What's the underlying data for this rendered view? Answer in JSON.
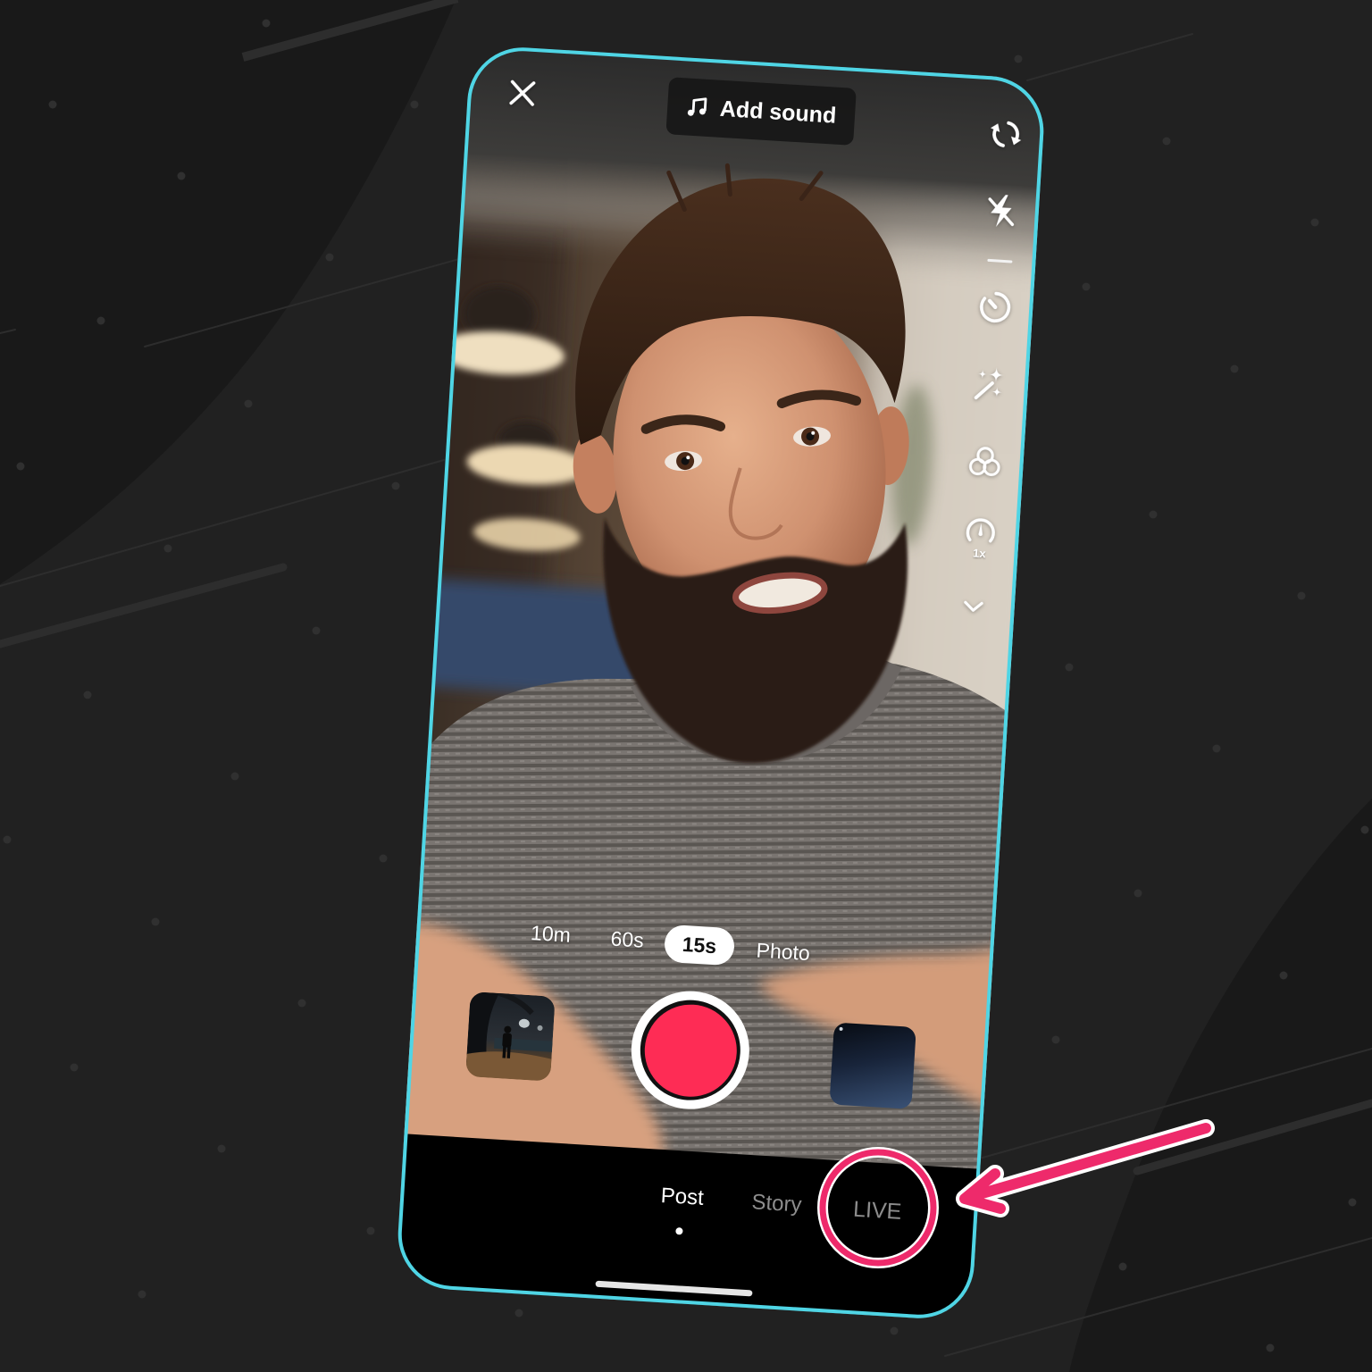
{
  "top_bar": {
    "close_icon": "close-icon",
    "add_sound": {
      "icon": "music-note-icon",
      "label": "Add sound"
    }
  },
  "side_tools": [
    {
      "name": "flip-camera",
      "icon": "flip-camera-icon"
    },
    {
      "name": "flash",
      "icon": "flash-off-icon",
      "state": "off"
    },
    {
      "name": "timer",
      "icon": "timer-icon"
    },
    {
      "name": "effects",
      "icon": "magic-wand-icon"
    },
    {
      "name": "filters",
      "icon": "filters-icon"
    },
    {
      "name": "speed",
      "icon": "speed-icon",
      "badge": "1x"
    },
    {
      "name": "more-tools",
      "icon": "chevron-down-icon"
    }
  ],
  "duration_tabs": [
    {
      "label": "10m",
      "selected": false
    },
    {
      "label": "60s",
      "selected": false
    },
    {
      "label": "15s",
      "selected": true
    },
    {
      "label": "Photo",
      "selected": false
    }
  ],
  "capture_row": {
    "gallery_thumbnail": {
      "icon": "gallery-thumbnail",
      "content": "night path with walking person"
    },
    "record_button": {
      "icon": "record-button",
      "color": "#fe2c55"
    },
    "effects_thumbnail": {
      "icon": "effects-thumbnail",
      "content": "dark blue gradient"
    }
  },
  "mode_tabs": [
    {
      "label": "Post",
      "active": true
    },
    {
      "label": "Story",
      "active": false
    },
    {
      "label": "LIVE",
      "active": false,
      "highlighted": true
    }
  ],
  "annotation": {
    "shape": "circle-with-arrow",
    "target": "LIVE",
    "color": "#ee2a6b"
  },
  "colors": {
    "background": "#212121",
    "phone_outline": "#4fd5e5",
    "record": "#fe2c55",
    "annotation": "#ee2a6b",
    "inactive_tab_text": "#8d8d8d",
    "active_tab_text": "#ffffff"
  }
}
